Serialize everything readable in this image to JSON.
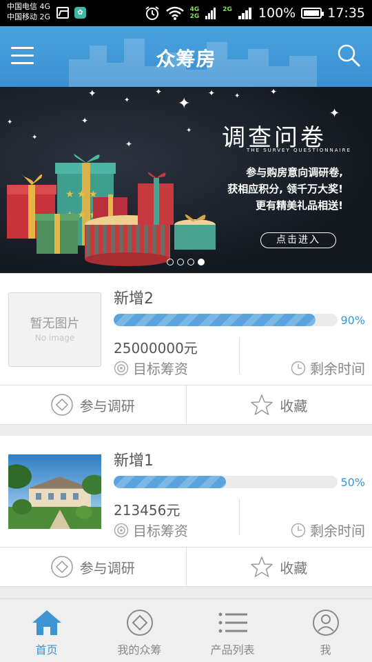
{
  "status_bar": {
    "carrier_line1": "中国电信 4G",
    "carrier_line2": "中国移动 2G",
    "battery": "100%",
    "time": "17:35"
  },
  "header": {
    "title": "众筹房"
  },
  "banner": {
    "heading": "调查问卷",
    "subheading": "THE SURVEY QUESTIONNAIRE",
    "text_lines": [
      "参与购房意向调研卷,",
      "获相应积分, 领千万大奖!",
      "更有精美礼品相送!"
    ],
    "button_label": "点击进入",
    "page_count": 4,
    "active_page": 4
  },
  "projects": [
    {
      "name": "新增2",
      "progress_percent": 90,
      "progress_label": "90%",
      "amount": "25000000元",
      "target_label": "目标筹资",
      "remaining_label": "剩余时间",
      "image_placeholder": "暂无图片",
      "image_placeholder_sub": "No image",
      "has_image": false,
      "survey_label": "参与调研",
      "favorite_label": "收藏"
    },
    {
      "name": "新增1",
      "progress_percent": 50,
      "progress_label": "50%",
      "amount": "213456元",
      "target_label": "目标筹资",
      "remaining_label": "剩余时间",
      "has_image": true,
      "survey_label": "参与调研",
      "favorite_label": "收藏"
    }
  ],
  "tabbar": {
    "items": [
      {
        "label": "首页",
        "icon": "home-icon",
        "active": true
      },
      {
        "label": "我的众筹",
        "icon": "diamond-icon",
        "active": false
      },
      {
        "label": "产品列表",
        "icon": "list-icon",
        "active": false
      },
      {
        "label": "我",
        "icon": "user-icon",
        "active": false
      }
    ]
  },
  "colors": {
    "accent": "#3d94d2",
    "header": "#4aa3df",
    "status_bar": "#000000"
  }
}
